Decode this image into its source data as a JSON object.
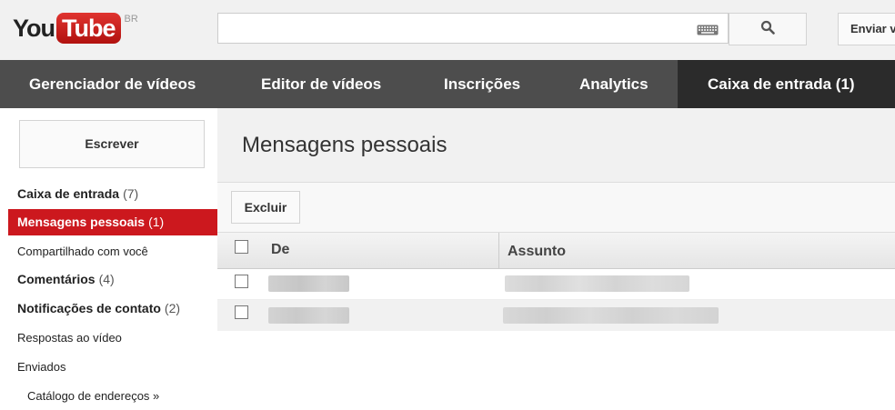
{
  "header": {
    "logo_you": "You",
    "logo_tube": "Tube",
    "logo_region": "BR",
    "search_value": "",
    "upload_label": "Enviar v"
  },
  "nav": {
    "items": [
      {
        "label": "Gerenciador de vídeos"
      },
      {
        "label": "Editor de vídeos"
      },
      {
        "label": "Inscrições"
      },
      {
        "label": "Analytics"
      },
      {
        "label": "Caixa de entrada (1)",
        "active": true
      }
    ]
  },
  "sidebar": {
    "compose_label": "Escrever",
    "items": [
      {
        "label": "Caixa de entrada",
        "count": "(7)"
      },
      {
        "label": "Mensagens pessoais",
        "count": "(1)",
        "active": true
      },
      {
        "label": "Compartilhado com você",
        "count": ""
      },
      {
        "label": "Comentários",
        "count": "(4)"
      },
      {
        "label": "Notificações de contato",
        "count": "(2)"
      },
      {
        "label": "Respostas ao vídeo",
        "count": ""
      },
      {
        "label": "Enviados",
        "count": ""
      },
      {
        "label": "Catálogo de endereços »",
        "count": ""
      }
    ]
  },
  "main": {
    "title": "Mensagens pessoais",
    "delete_label": "Excluir",
    "columns": {
      "from": "De",
      "subject": "Assunto"
    },
    "rows": [
      {
        "from": "",
        "subject": ""
      },
      {
        "from": "",
        "subject": ""
      }
    ]
  },
  "colors": {
    "nav_bg": "#4d4d4d",
    "nav_active_bg": "#2b2b2b",
    "accent_red": "#cc181e"
  }
}
